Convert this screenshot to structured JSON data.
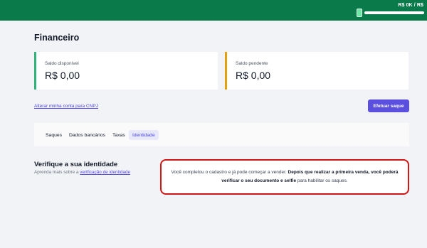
{
  "topbar": {
    "goal_text": "R$ 0K / R$",
    "goal_progress": 0
  },
  "page": {
    "title": "Financeiro"
  },
  "balances": {
    "available": {
      "label": "Saldo disponível",
      "value": "R$ 0,00"
    },
    "pending": {
      "label": "Saldo pendente",
      "value": "R$ 0,00"
    }
  },
  "actions": {
    "cnpj_link": "Alterar minha conta para CNPJ",
    "withdraw_button": "Efetuar saque"
  },
  "tabs": [
    {
      "label": "Saques",
      "active": false
    },
    {
      "label": "Dados bancários",
      "active": false
    },
    {
      "label": "Taxas",
      "active": false
    },
    {
      "label": "Identidade",
      "active": true
    }
  ],
  "identity": {
    "title": "Verifique a sua identidade",
    "subtitle_prefix": "Aprenda mais sobre a ",
    "subtitle_link": "verificação de identidade",
    "notice_part1": "Você completou o cadastro e já pode começar a vender. ",
    "notice_bold": "Depois que realizar a primeira venda, você poderá verificar o seu documento e selfie",
    "notice_part2": " para habilitar os saques."
  },
  "colors": {
    "topbar": "#0b7a4b",
    "accent": "#5b4fe0",
    "available_stripe": "#2fb37a",
    "pending_stripe": "#e3a008",
    "notice_border": "#d31414"
  }
}
